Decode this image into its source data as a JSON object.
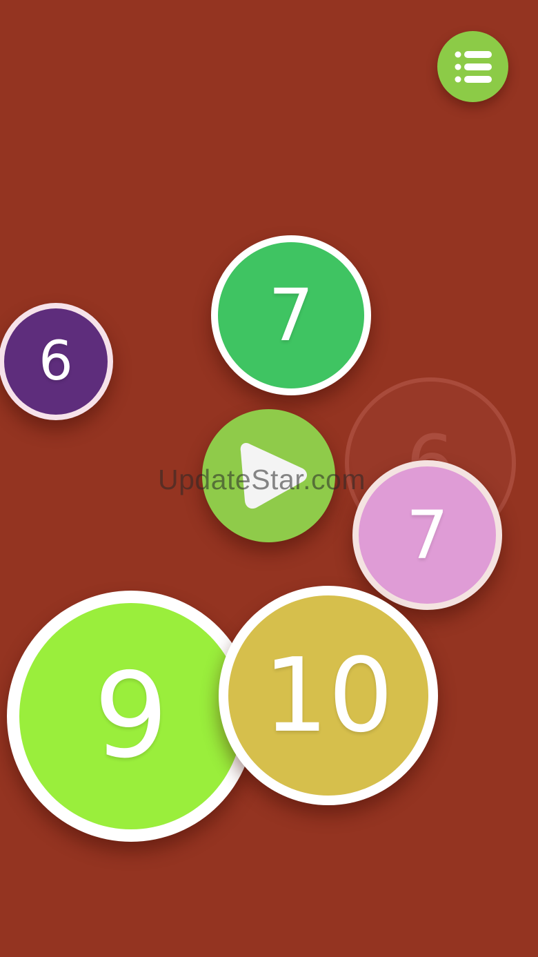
{
  "menu": {
    "icon": "list-menu-icon"
  },
  "play": {
    "icon": "play-icon"
  },
  "balls": [
    {
      "id": "green",
      "value": "7",
      "color": "#3fc462"
    },
    {
      "id": "purple",
      "value": "6",
      "color": "#5e2d7c"
    },
    {
      "id": "ghost",
      "value": "6",
      "color": "#a04637"
    },
    {
      "id": "pink",
      "value": "7",
      "color": "#df9cd6"
    },
    {
      "id": "lime",
      "value": "9",
      "color": "#9aee3c"
    },
    {
      "id": "gold",
      "value": "10",
      "color": "#d6bf4c"
    }
  ],
  "watermark": "UpdateStar.com",
  "colors": {
    "background": "#943421",
    "button": "#8ccb47"
  }
}
